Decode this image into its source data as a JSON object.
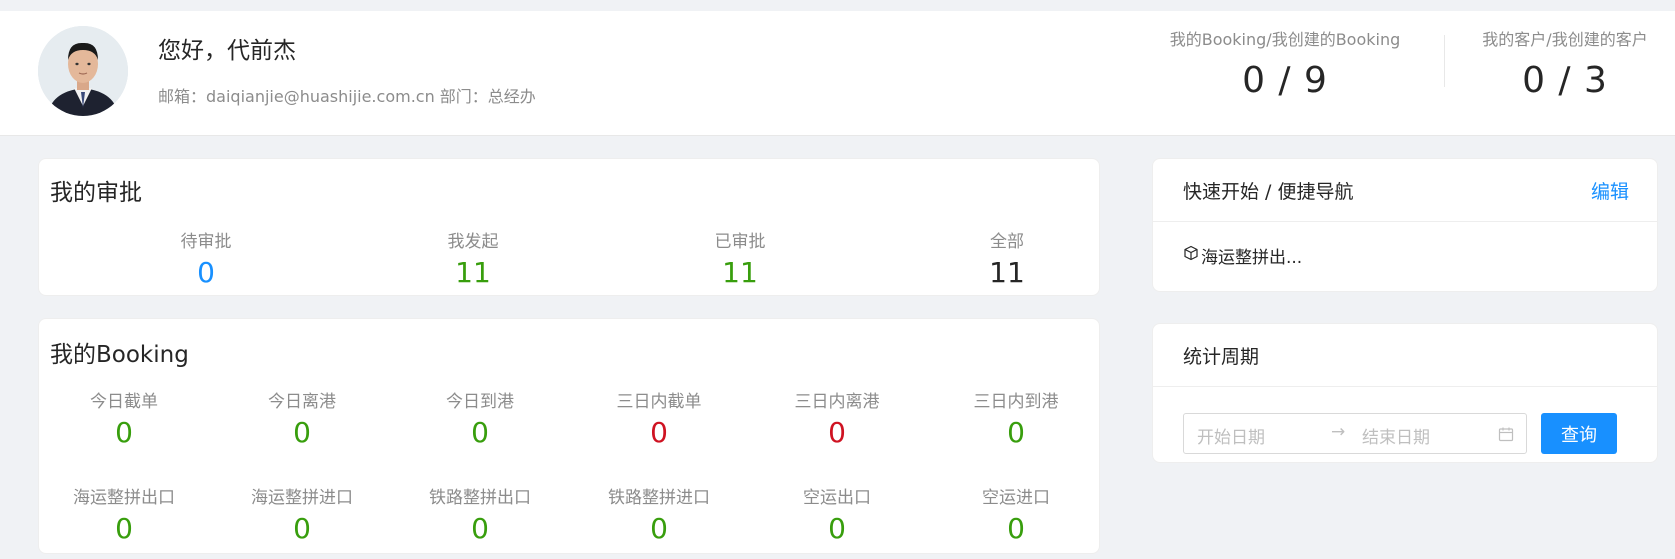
{
  "user": {
    "greeting": "您好，代前杰",
    "meta": "邮箱：daiqianjie@huashijie.com.cn 部门：总经办"
  },
  "header_stats": [
    {
      "label": "我的Booking/我创建的Booking",
      "value": "0 / 9"
    },
    {
      "label": "我的客户/我创建的客户",
      "value": "0 / 3"
    }
  ],
  "approval": {
    "title": "我的审批",
    "items": [
      {
        "label": "待审批",
        "value": "0",
        "color": "#1890ff"
      },
      {
        "label": "我发起",
        "value": "11",
        "color": "#389e0d"
      },
      {
        "label": "已审批",
        "value": "11",
        "color": "#389e0d"
      },
      {
        "label": "全部",
        "value": "11",
        "color": "#262626"
      }
    ]
  },
  "booking": {
    "title": "我的Booking",
    "items": [
      {
        "label": "今日截单",
        "value": "0",
        "color": "#389e0d"
      },
      {
        "label": "今日离港",
        "value": "0",
        "color": "#389e0d"
      },
      {
        "label": "今日到港",
        "value": "0",
        "color": "#389e0d"
      },
      {
        "label": "三日内截单",
        "value": "0",
        "color": "#cf1322"
      },
      {
        "label": "三日内离港",
        "value": "0",
        "color": "#cf1322"
      },
      {
        "label": "三日内到港",
        "value": "0",
        "color": "#389e0d"
      },
      {
        "label": "海运整拼出口",
        "value": "0",
        "color": "#389e0d"
      },
      {
        "label": "海运整拼进口",
        "value": "0",
        "color": "#389e0d"
      },
      {
        "label": "铁路整拼出口",
        "value": "0",
        "color": "#389e0d"
      },
      {
        "label": "铁路整拼进口",
        "value": "0",
        "color": "#389e0d"
      },
      {
        "label": "空运出口",
        "value": "0",
        "color": "#389e0d"
      },
      {
        "label": "空运进口",
        "value": "0",
        "color": "#389e0d"
      }
    ]
  },
  "quick_nav": {
    "title": "快速开始 / 便捷导航",
    "edit_label": "编辑",
    "items": [
      {
        "label": "海运整拼出...",
        "icon": "box-icon"
      }
    ]
  },
  "period": {
    "title": "统计周期",
    "start_placeholder": "开始日期",
    "end_placeholder": "结束日期",
    "query_label": "查询"
  }
}
